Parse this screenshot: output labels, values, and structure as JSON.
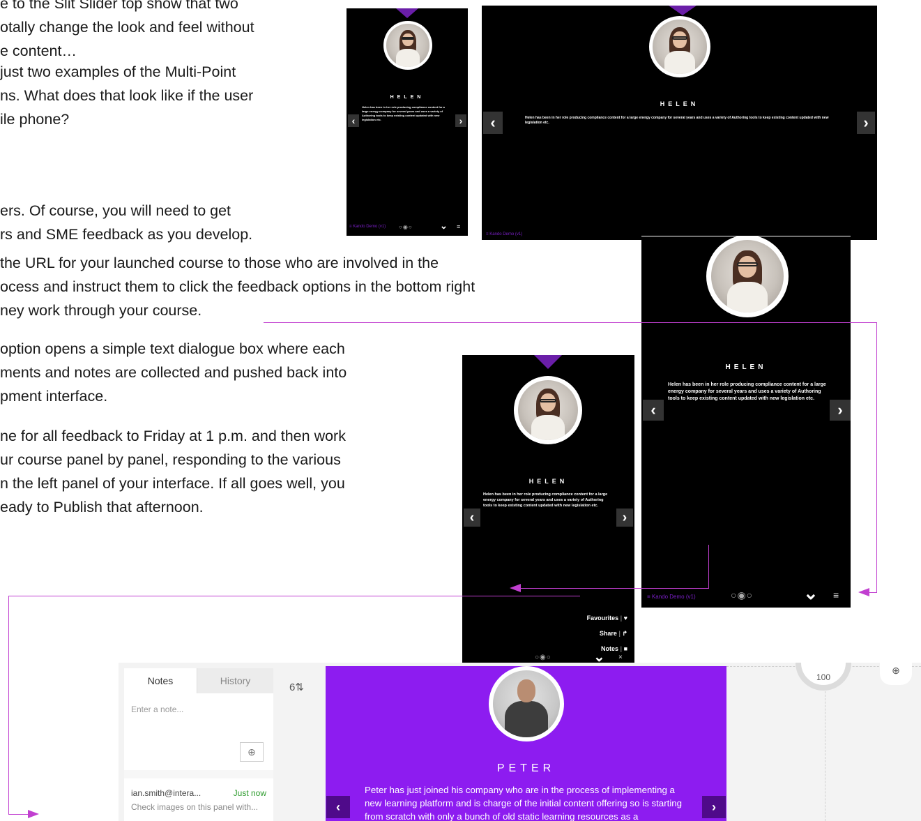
{
  "document": {
    "lines_block1": [
      "e to the Slit Slider top show that two",
      "otally change the look and feel without",
      "e content…"
    ],
    "lines_block2": [
      "just two examples of the Multi-Point",
      "ns. What does that look like if the user",
      "ile phone?"
    ],
    "lines_block3": [
      "ers. Of course, you will need to get",
      "rs and SME feedback as you develop."
    ],
    "lines_block4": [
      " the URL for your launched course to those who are involved in the",
      "ocess and instruct them to click the feedback options in the bottom right",
      "ney work through your course."
    ],
    "lines_block5": [
      "option opens a simple text dialogue box where each",
      "ments and notes are collected and pushed back into",
      "pment interface."
    ],
    "lines_block6": [
      "ne for all feedback to Friday at 1 p.m. and then work",
      "ur course panel by panel, responding to the various",
      "n the left panel of your interface. If all goes well, you",
      "eady to Publish that afternoon."
    ]
  },
  "preview": {
    "name": "HELEN",
    "bio": "Helen has been in her role producing compliance content for a large energy company for several years and uses a variety of Authoring tools to keep existing content updated with new legislation etc.",
    "footer_brand": "Kando Demo (v1)",
    "prev_icon": "chevron-left-icon",
    "next_icon": "chevron-right-icon",
    "prev_glyph": "‹",
    "next_glyph": "›",
    "dots": "○◉○",
    "collapse_glyph": "⌄",
    "menu_glyph": "≡",
    "brand_glyph": "≡",
    "close_glyph": "×"
  },
  "feedback_menu": {
    "items": [
      {
        "label": "Favourites",
        "icon": "heart-icon",
        "glyph": "♥"
      },
      {
        "label": "Share",
        "icon": "share-icon",
        "glyph": "↱"
      },
      {
        "label": "Notes",
        "icon": "note-icon",
        "glyph": "■"
      }
    ]
  },
  "editor": {
    "tabs": [
      "Notes",
      "History"
    ],
    "note_placeholder": "Enter a note...",
    "add_glyph": "⊕",
    "note": {
      "author": "ian.smith@intera...",
      "time": "Just now",
      "text": "Check images on this panel with..."
    },
    "panel_count": "6⇅",
    "panel": {
      "name": "PETER",
      "bio": "Peter has just joined his company who are in the process of implementing a new learning platform and is charge of the initial content offering so is starting from scratch with only a bunch of old static learning resources as a",
      "background": "#8d1cf0",
      "prev_glyph": "‹",
      "next_glyph": "›"
    },
    "zoom_value": "100",
    "zoom_icon": "zoom-in-icon",
    "zoom_glyph": "⊕"
  },
  "colors": {
    "connector": "#c13fd0",
    "accent": "#6a1ea8"
  }
}
